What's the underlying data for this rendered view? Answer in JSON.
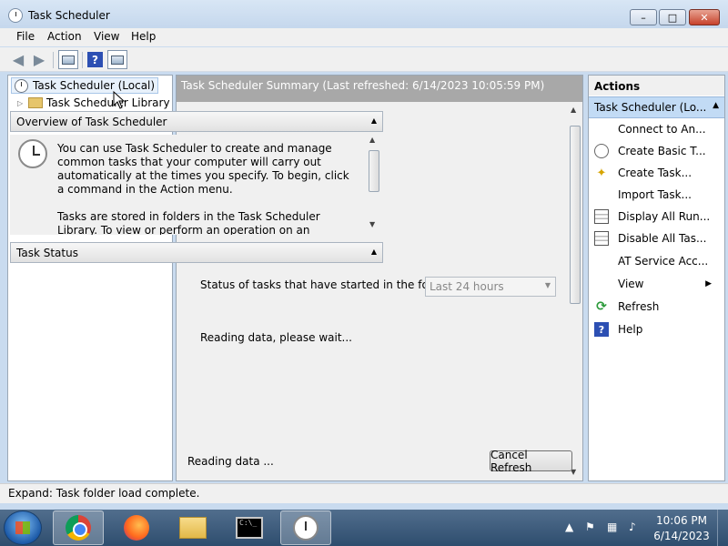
{
  "window": {
    "title": "Task Scheduler"
  },
  "menu": [
    "File",
    "Action",
    "View",
    "Help"
  ],
  "tree": {
    "root": "Task Scheduler (Local)",
    "child": "Task Scheduler Library"
  },
  "center": {
    "summary_title": "Task Scheduler Summary (Last refreshed: 6/14/2023 10:05:59 PM)",
    "overview_title": "Overview of Task Scheduler",
    "overview_p1": "You can use Task Scheduler to create and manage common tasks that your computer will carry out automatically at the times you specify. To begin, click a command in the Action menu.",
    "overview_p2": "Tasks are stored in folders in the Task Scheduler Library. To view or perform an operation on an individual task, select the",
    "status_title": "Task Status",
    "status_label": "Status of tasks that have started in the follo...",
    "status_range": "Last 24 hours",
    "reading_status": "Reading data, please wait...",
    "reading_footer": "Reading data ...",
    "cancel_label": "Cancel Refresh"
  },
  "actions": {
    "title": "Actions",
    "group": "Task Scheduler (Lo...",
    "items": [
      {
        "label": "Connect to An...",
        "icon": "none"
      },
      {
        "label": "Create Basic T...",
        "icon": "clock-icon"
      },
      {
        "label": "Create Task...",
        "icon": "sparkle-icon"
      },
      {
        "label": "Import Task...",
        "icon": "none"
      },
      {
        "label": "Display All Run...",
        "icon": "list-icon"
      },
      {
        "label": "Disable All Tas...",
        "icon": "list-icon"
      },
      {
        "label": "AT Service Acc...",
        "icon": "none"
      },
      {
        "label": "View",
        "icon": "none"
      },
      {
        "label": "Refresh",
        "icon": "refresh-icon"
      },
      {
        "label": "Help",
        "icon": "help-icon"
      }
    ]
  },
  "statusbar": {
    "text": "Expand:  Task folder load complete."
  },
  "taskbar": {
    "time": "10:06 PM",
    "date": "6/14/2023"
  }
}
